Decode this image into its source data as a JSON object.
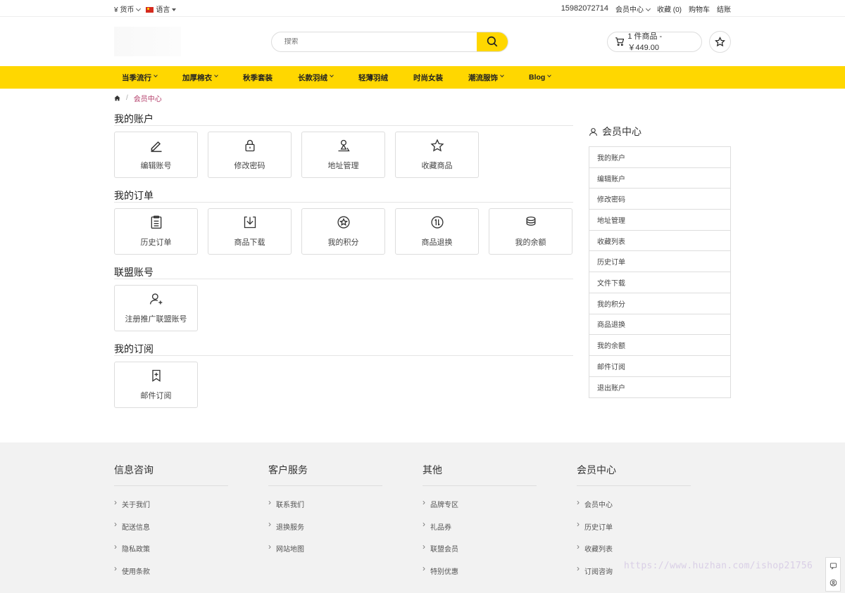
{
  "topbar": {
    "currency_label": "¥ 货币",
    "language_label": "语言",
    "phone": "15982072714",
    "member_center": "会员中心",
    "wishlist": "收藏",
    "wishlist_count": "(0)",
    "cart": "购物车",
    "checkout": "结账"
  },
  "header": {
    "search_placeholder": "搜索",
    "cart_summary": "1 件商品 - ￥449.00"
  },
  "nav": {
    "items": [
      {
        "label": "当季流行"
      },
      {
        "label": "加厚棉衣"
      },
      {
        "label": "秋季套装"
      },
      {
        "label": "长款羽绒"
      },
      {
        "label": "轻薄羽绒"
      },
      {
        "label": "时尚女装"
      },
      {
        "label": "潮流服饰"
      },
      {
        "label": "Blog"
      }
    ]
  },
  "breadcrumb": {
    "separator": "/",
    "current": "会员中心"
  },
  "sections": {
    "account": {
      "title": "我的账户",
      "tiles": [
        "编辑账号",
        "修改密码",
        "地址管理",
        "收藏商品"
      ]
    },
    "orders": {
      "title": "我的订单",
      "tiles": [
        "历史订单",
        "商品下载",
        "我的积分",
        "商品退换",
        "我的余额"
      ]
    },
    "affiliate": {
      "title": "联盟账号",
      "tiles": [
        "注册推广联盟账号"
      ]
    },
    "subscription": {
      "title": "我的订阅",
      "tiles": [
        "邮件订阅"
      ]
    }
  },
  "sidebar": {
    "title": "会员中心",
    "items": [
      "我的账户",
      "编辑账户",
      "修改密码",
      "地址管理",
      "收藏列表",
      "历史订单",
      "文件下载",
      "我的积分",
      "商品退换",
      "我的余额",
      "邮件订阅",
      "退出账户"
    ]
  },
  "footer": {
    "columns": [
      {
        "title": "信息咨询",
        "links": [
          "关于我们",
          "配送信息",
          "隐私政策",
          "使用条款"
        ]
      },
      {
        "title": "客户服务",
        "links": [
          "联系我们",
          "退换服务",
          "网站地图"
        ]
      },
      {
        "title": "其他",
        "links": [
          "品牌专区",
          "礼品券",
          "联盟会员",
          "特别优惠"
        ]
      },
      {
        "title": "会员中心",
        "links": [
          "会员中心",
          "历史订单",
          "收藏列表",
          "订阅咨询"
        ]
      }
    ]
  },
  "watermark": "https://www.huzhan.com/ishop21756",
  "colors": {
    "accent": "#ffd700",
    "breadcrumb_current": "#b33e6a"
  }
}
